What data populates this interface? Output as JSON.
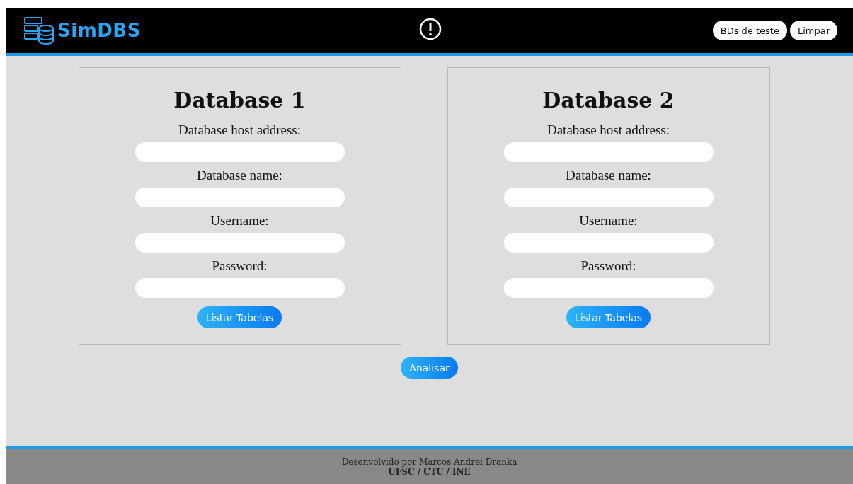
{
  "header": {
    "logo_text": "SimDBS",
    "buttons": [
      "BDs de teste",
      "Limpar"
    ]
  },
  "databases": [
    {
      "title": "Database 1",
      "fields": [
        {
          "label": "Database host address:"
        },
        {
          "label": "Database name:"
        },
        {
          "label": "Username:"
        },
        {
          "label": "Password:"
        }
      ],
      "button": "Listar Tabelas"
    },
    {
      "title": "Database 2",
      "fields": [
        {
          "label": "Database host address:"
        },
        {
          "label": "Database name:"
        },
        {
          "label": "Username:"
        },
        {
          "label": "Password:"
        }
      ],
      "button": "Listar Tabelas"
    }
  ],
  "analyze_button": "Analisar",
  "footer": {
    "credit": "Desenvolvido por Marcos Andrei Dranka",
    "institution": "UFSC / CTC / INE"
  }
}
